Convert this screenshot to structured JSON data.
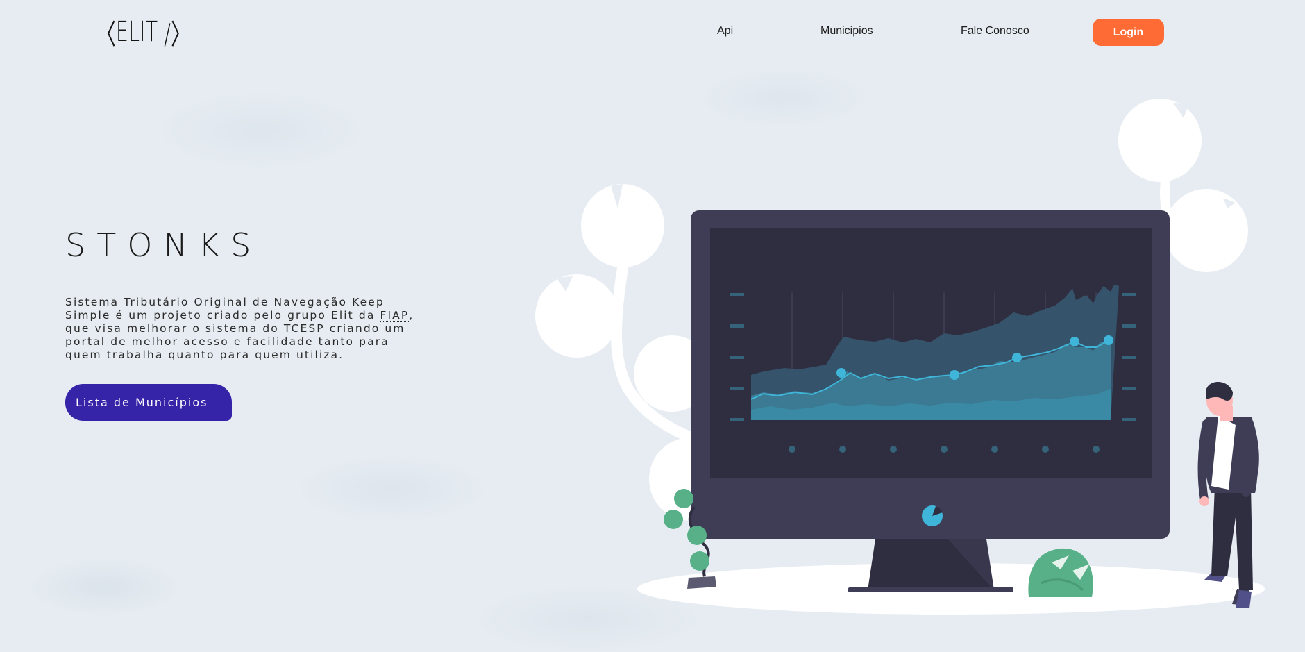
{
  "nav": {
    "logo": "ELIT",
    "links": [
      "Api",
      "Municipios",
      "Fale Conosco"
    ],
    "login_label": "Login"
  },
  "hero": {
    "title": "STONKS",
    "description_parts": [
      "Sistema Tributário Original de Navegação Keep Simple é um projeto criado pelo grupo Elit da ",
      "FIAP",
      ", que visa melhorar o sistema do ",
      "TCESP",
      " criando um portal de melhor acesso e facilidade tanto para quem trabalha quanto para quem utiliza."
    ],
    "cta_label": "Lista de Municípios"
  },
  "colors": {
    "accent": "#ff6b35",
    "cta": "#3523a8",
    "monitor": "#3f3d56",
    "screen": "#2f2e41",
    "chart_line": "#3fb6d9",
    "plant_green": "#57b087"
  },
  "icons": {
    "logo_brackets": "code-bracket-icon"
  }
}
